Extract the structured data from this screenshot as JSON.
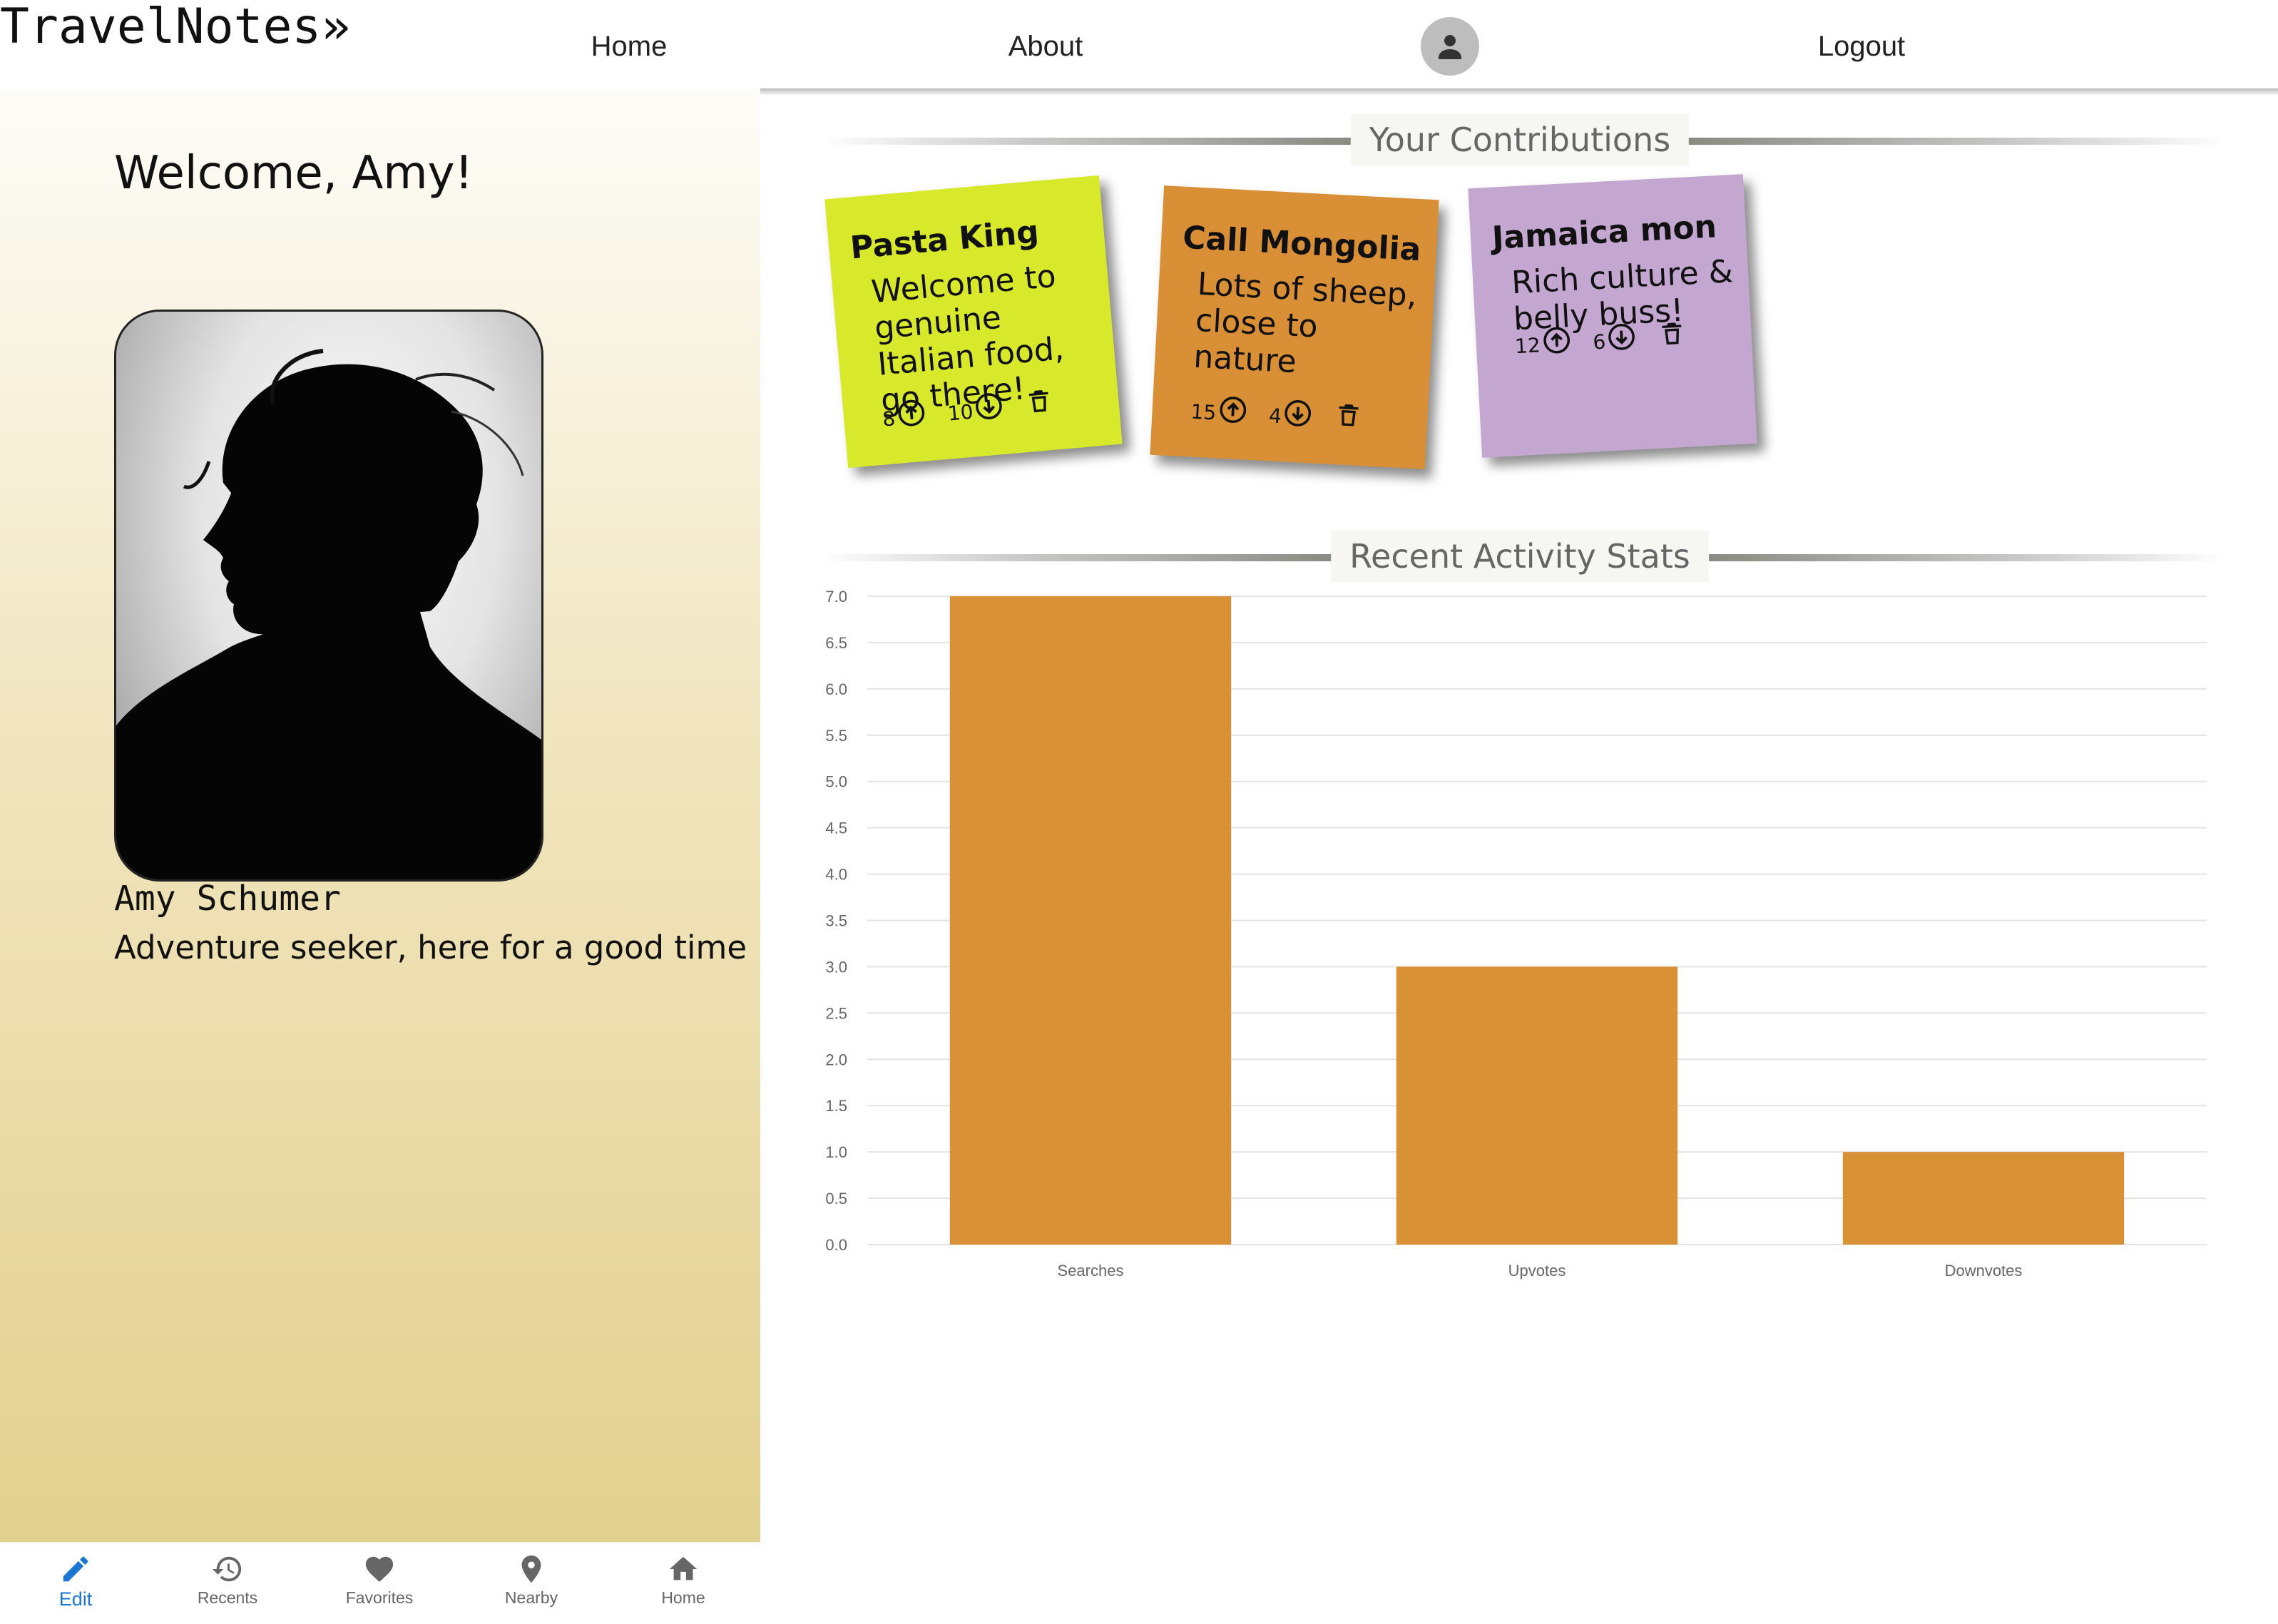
{
  "app": {
    "brand": "TravelNotes»"
  },
  "navbar": {
    "links": [
      {
        "id": "home",
        "label": "Home"
      },
      {
        "id": "about",
        "label": "About"
      },
      {
        "id": "logout",
        "label": "Logout"
      }
    ],
    "avatar_icon": "account-circle-icon"
  },
  "profile": {
    "welcome": "Welcome, Amy!",
    "name": "Amy Schumer",
    "bio": "Adventure seeker, here for a good time",
    "photo_icon": "profile-silhouette-photo"
  },
  "contributions": {
    "heading": "Your Contributions",
    "notes": [
      {
        "title": "Pasta King",
        "body": "Welcome to genuine Italian food, go there!",
        "upvotes": "8",
        "downvotes": "10",
        "color": "#d8e92c",
        "rotation_deg": -5
      },
      {
        "title": "Call Mongolia",
        "body": "Lots of sheep, close to nature",
        "upvotes": "15",
        "downvotes": "4",
        "color": "#d98f35",
        "rotation_deg": 3
      },
      {
        "title": "Jamaica mon",
        "body": "Rich culture & belly buss!",
        "upvotes": "12",
        "downvotes": "6",
        "color": "#c3a7d1",
        "rotation_deg": -3
      }
    ]
  },
  "stats": {
    "heading": "Recent Activity Stats"
  },
  "chart_data": {
    "type": "bar",
    "title": "",
    "xlabel": "",
    "ylabel": "",
    "categories": [
      "Searches",
      "Upvotes",
      "Downvotes"
    ],
    "values": [
      7,
      3,
      1
    ],
    "ylim": [
      0,
      7
    ],
    "yticks": [
      "0.0",
      "0.5",
      "1.0",
      "1.5",
      "2.0",
      "2.5",
      "3.0",
      "3.5",
      "4.0",
      "4.5",
      "5.0",
      "5.5",
      "6.0",
      "6.5",
      "7.0"
    ],
    "bar_color": "#d99135",
    "grid": true,
    "legend": "none"
  },
  "bottom_nav": {
    "items": [
      {
        "id": "edit",
        "label": "Edit",
        "icon": "pencil-icon",
        "active": true
      },
      {
        "id": "recents",
        "label": "Recents",
        "icon": "history-icon",
        "active": false
      },
      {
        "id": "favorites",
        "label": "Favorites",
        "icon": "heart-icon",
        "active": false
      },
      {
        "id": "nearby",
        "label": "Nearby",
        "icon": "location-pin-icon",
        "active": false
      },
      {
        "id": "home",
        "label": "Home",
        "icon": "home-icon",
        "active": false
      }
    ]
  },
  "colors": {
    "accent": "#1976d2",
    "bar": "#d99135",
    "panel_top": "#fdfcf8",
    "panel_bottom": "#e2d08e"
  }
}
